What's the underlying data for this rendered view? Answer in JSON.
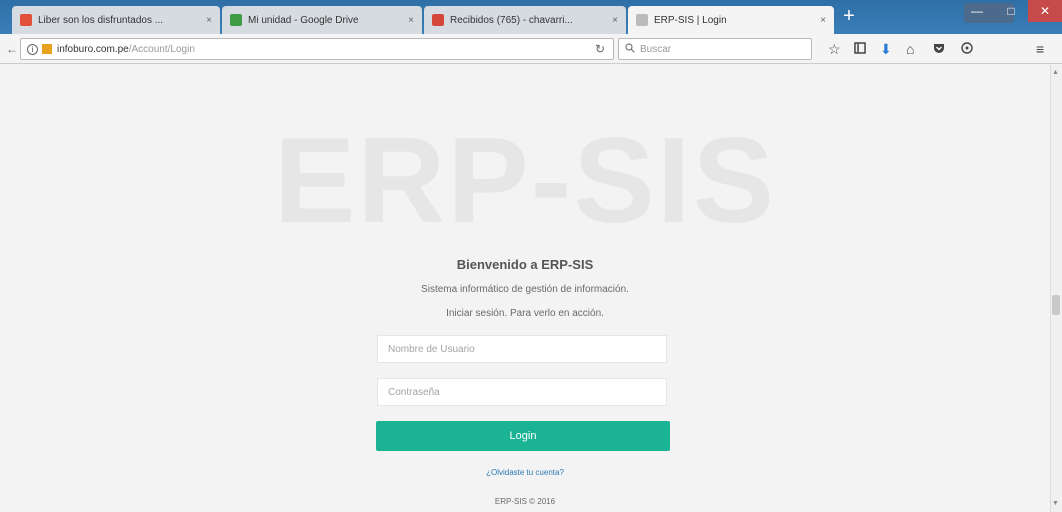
{
  "browser": {
    "tabs": [
      {
        "label": "Liber son los disfruntados ...",
        "favicon_color": "#e0503a",
        "active": false
      },
      {
        "label": "Mi unidad - Google Drive",
        "favicon_color": "#3f9c45",
        "active": false
      },
      {
        "label": "Recibidos (765) - chavarri...",
        "favicon_color": "#d44638",
        "active": false
      },
      {
        "label": "ERP-SIS | Login",
        "favicon_color": "#bbbbbb",
        "active": true
      }
    ],
    "new_tab_label": "+",
    "url_host": "infoburo.com.pe",
    "url_path": "/Account/Login",
    "search_placeholder": "Buscar",
    "window_controls": {
      "minimize": "—",
      "maximize": "□",
      "close": "✕"
    }
  },
  "login": {
    "logo_text": "ERP-SIS",
    "welcome": "Bienvenido a ERP-SIS",
    "subtitle": "Sistema informático de gestión de información.",
    "subtitle2": "Iniciar sesión. Para verlo en acción.",
    "username_placeholder": "Nombre de Usuario",
    "password_placeholder": "Contraseña",
    "login_button": "Login",
    "forgot_link": "¿Olvidaste tu cuenta?",
    "copyright": "ERP-SIS © 2016"
  },
  "colors": {
    "accent": "#1ab394",
    "background": "#f3f3f4",
    "tabbar": "#3a7fb9"
  }
}
